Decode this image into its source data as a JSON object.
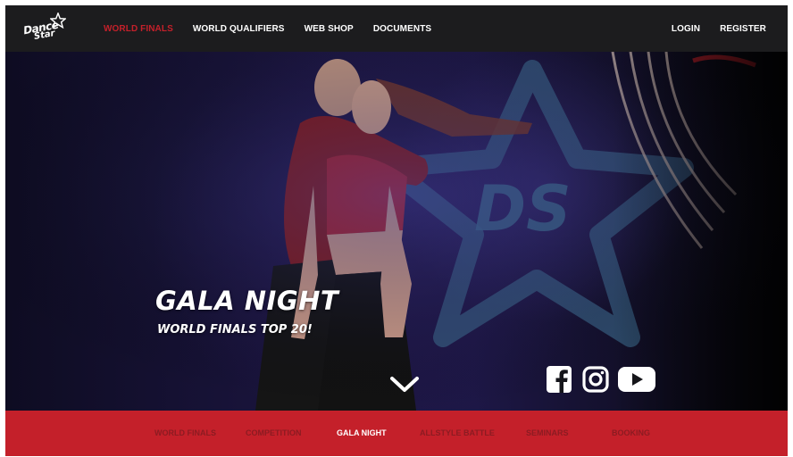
{
  "logo": {
    "line1": "Dance",
    "line2": "Star"
  },
  "top_nav": {
    "items": [
      {
        "label": "WORLD FINALS",
        "active": true
      },
      {
        "label": "WORLD QUALIFIERS",
        "active": false
      },
      {
        "label": "WEB SHOP",
        "active": false
      },
      {
        "label": "DOCUMENTS",
        "active": false
      }
    ],
    "login": "LOGIN",
    "register": "REGISTER"
  },
  "hero": {
    "title": "GALA NIGHT",
    "subtitle": "WORLD FINALS TOP 20!",
    "backdrop_letters": "DS",
    "social": [
      "facebook-icon",
      "instagram-icon",
      "youtube-icon"
    ]
  },
  "sub_nav": {
    "items": [
      {
        "label": "WORLD FINALS",
        "active": false
      },
      {
        "label": "COMPETITION",
        "active": false
      },
      {
        "label": "GALA NIGHT",
        "active": true
      },
      {
        "label": "ALLSTYLE BATTLE",
        "active": false
      },
      {
        "label": "SEMINARS",
        "active": false
      },
      {
        "label": "BOOKING",
        "active": false
      }
    ]
  },
  "colors": {
    "brand_red": "#c4202a",
    "nav_bg": "#1c1c1e",
    "inactive_sub": "#8c1b22"
  }
}
